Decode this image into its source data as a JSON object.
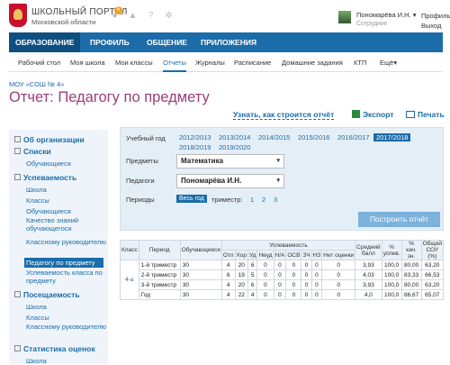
{
  "header": {
    "portal_title": "ШКОЛЬНЫЙ ПОРТАЛ",
    "portal_subtitle": "Московской области",
    "notif_count": "5",
    "user_name": "Пономарёва И.Н.",
    "user_role": "Сотрудник",
    "profile_link": "Профиль",
    "logout_link": "Выход"
  },
  "nav": [
    "ОБРАЗОВАНИЕ",
    "ПРОФИЛЬ",
    "ОБЩЕНИЕ",
    "ПРИЛОЖЕНИЯ"
  ],
  "subnav": [
    "Рабочий стол",
    "Моя школа",
    "Мои классы",
    "Отчеты",
    "Журналы",
    "Расписание",
    "Домашние задания",
    "КТП",
    "Ещё"
  ],
  "breadcrumb": "МОУ «СОШ № 4»",
  "page_title": "Отчет: Педагогу по предмету",
  "actions": {
    "how_built": "Узнать, как строится отчёт",
    "export": "Экспорт",
    "print": "Печать"
  },
  "sidebar": {
    "sections": [
      "Об организации",
      "Списки",
      "Успеваемость",
      "Посещаемость",
      "Статистика оценок"
    ],
    "items": {
      "spiski": [
        "Обучающиеся"
      ],
      "usp": [
        "Школа",
        "Классы",
        "Обучающиеся",
        "Качество знаний обучающегося",
        "Классному руководителю",
        "Педагогу по предмету",
        "Успеваемость класса по предмету"
      ],
      "pos": [
        "Школа",
        "Классы",
        "Классному руководителю"
      ],
      "stat": [
        "Школа"
      ]
    }
  },
  "filters": {
    "year_label": "Учебный год",
    "years": [
      "2012/2013",
      "2013/2014",
      "2014/2015",
      "2015/2016",
      "2016/2017",
      "2017/2018",
      "2018/2019",
      "2019/2020"
    ],
    "subject_label": "Предметы",
    "subject_value": "Математика",
    "teacher_label": "Педагоги",
    "teacher_value": "Пономарёва И.Н.",
    "period_label": "Периоды",
    "period_all": "Весь год",
    "trimester_label": "триместр:",
    "trimesters": [
      "1",
      "2",
      "3"
    ],
    "build_button": "Построить отчёт"
  },
  "table": {
    "h": {
      "cls": "Класс",
      "period": "Период",
      "students": "Обучающиеся",
      "perf": "Успеваемость",
      "avg": "Средний балл",
      "pct_usp": "% успев.",
      "pct_kach": "% кач. зн.",
      "sou": "Общий СОУ (%)"
    },
    "sub": [
      "Отл",
      "Хор",
      "Уд",
      "Неуд",
      "Н/А",
      "ОСВ",
      "ЗЧ",
      "НЗ",
      "Нет оценки"
    ],
    "class_name": "4-а",
    "rows": [
      {
        "period": "1-й триместр",
        "students": "30",
        "vals": [
          "4",
          "20",
          "6",
          "0",
          "0",
          "0",
          "0",
          "0",
          "0"
        ],
        "avg": "3,93",
        "usp": "100,0",
        "kach": "80,00",
        "sou": "63,20"
      },
      {
        "period": "2-й триместр",
        "students": "30",
        "vals": [
          "6",
          "19",
          "5",
          "0",
          "0",
          "0",
          "0",
          "0",
          "0"
        ],
        "avg": "4,03",
        "usp": "100,0",
        "kach": "83,33",
        "sou": "66,53"
      },
      {
        "period": "3-й триместр",
        "students": "30",
        "vals": [
          "4",
          "20",
          "6",
          "0",
          "0",
          "0",
          "0",
          "0",
          "0"
        ],
        "avg": "3,93",
        "usp": "100,0",
        "kach": "80,00",
        "sou": "63,20"
      },
      {
        "period": "Год",
        "students": "30",
        "vals": [
          "4",
          "22",
          "4",
          "0",
          "0",
          "0",
          "0",
          "0",
          "0"
        ],
        "avg": "4,0",
        "usp": "100,0",
        "kach": "86,67",
        "sou": "65,07"
      }
    ]
  }
}
